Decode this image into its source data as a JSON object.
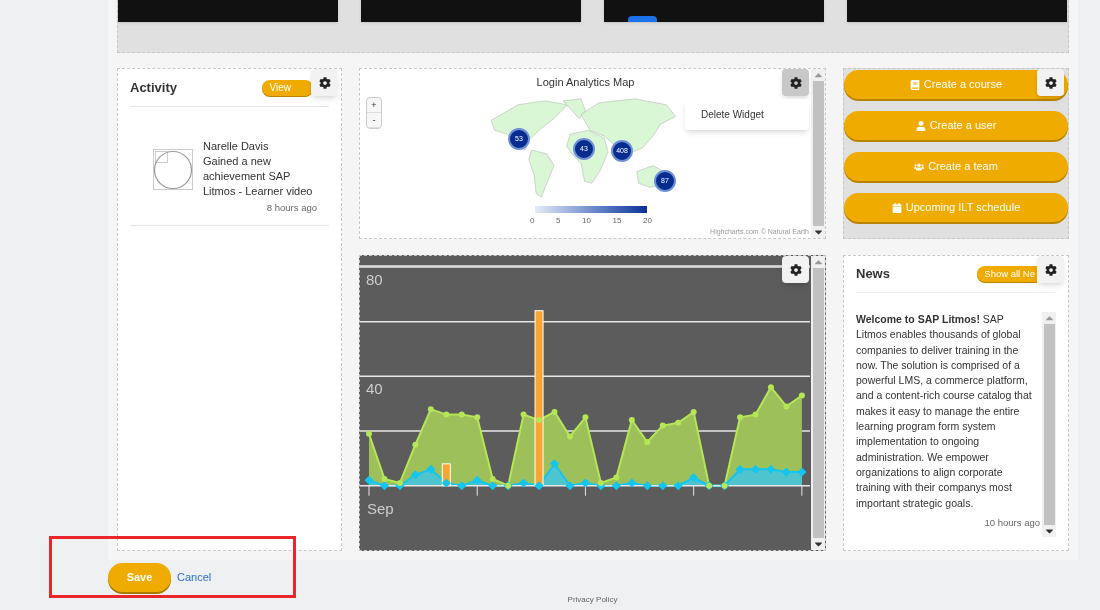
{
  "activity": {
    "title": "Activity",
    "view_button": "View",
    "items": [
      {
        "name": "Narelle Davis",
        "text": "Gained a new achievement SAP Litmos - Learner video",
        "time": "8 hours ago"
      }
    ]
  },
  "map_widget": {
    "title": "Login Analytics Map",
    "menu_open": true,
    "zoom_buttons": [
      "+",
      "-"
    ],
    "bubbles": [
      {
        "label": "53"
      },
      {
        "label": "43"
      },
      {
        "label": "408"
      },
      {
        "label": "87"
      }
    ],
    "legend_ticks": [
      "0",
      "5",
      "10",
      "15",
      "20"
    ],
    "credits": "Highcharts.com © Natural Earth",
    "menu_items": [
      "Delete Widget"
    ]
  },
  "chart_widget": {
    "x_axis_label": "Sep",
    "chart_data": {
      "type": "line",
      "grid": true,
      "ylim": [
        -23.5,
        84
      ],
      "yticks": [
        {
          "value": 40,
          "label": "40"
        },
        {
          "value": 80,
          "label": "80"
        }
      ],
      "series": [
        {
          "type": "area",
          "color": "#b5e655",
          "values": [
            19,
            2.5,
            1,
            15,
            28,
            26,
            26,
            25,
            2.5,
            0,
            26,
            24,
            27,
            18,
            25,
            1,
            3,
            24,
            16,
            22,
            23,
            27,
            0,
            0,
            25,
            26,
            36,
            29,
            33
          ]
        },
        {
          "type": "area",
          "color": "#13c5ef",
          "values": [
            2,
            0,
            0,
            4,
            6,
            1,
            0,
            2,
            0,
            0,
            1,
            0,
            8,
            0,
            1,
            0,
            0,
            1,
            0,
            0,
            0,
            3,
            0,
            0,
            6,
            6,
            6,
            5,
            5
          ]
        },
        {
          "type": "bar",
          "color": "#f7a535",
          "values": [
            null,
            null,
            null,
            null,
            null,
            8,
            null,
            null,
            null,
            null,
            null,
            64,
            null,
            null,
            null,
            null,
            null,
            null,
            null,
            null,
            null,
            null,
            null,
            null,
            null,
            null,
            null,
            null,
            null
          ]
        }
      ]
    }
  },
  "quick_actions": [
    {
      "label": "Create a course",
      "kind": "book"
    },
    {
      "label": "Create a user",
      "kind": "user"
    },
    {
      "label": "Create a team",
      "kind": "team"
    },
    {
      "label": "Upcoming ILT schedule",
      "kind": "calendar"
    }
  ],
  "news": {
    "title": "News",
    "show_all_button": "Show all Ne",
    "body": "**Welcome to SAP Litmos!** SAP Litmos enables thousands of global companies to deliver training in the now. The solution is comprised of a powerful LMS, a commerce platform, and a content-rich course catalog that makes it easy to manage the entire learning program form system implementation to ongoing administration. We empower organizations to align corporate training with their companys most important strategic goals.",
    "time": "10 hours ago"
  },
  "footer": {
    "save": "Save",
    "cancel": "Cancel",
    "privacy": "Privacy Policy"
  }
}
